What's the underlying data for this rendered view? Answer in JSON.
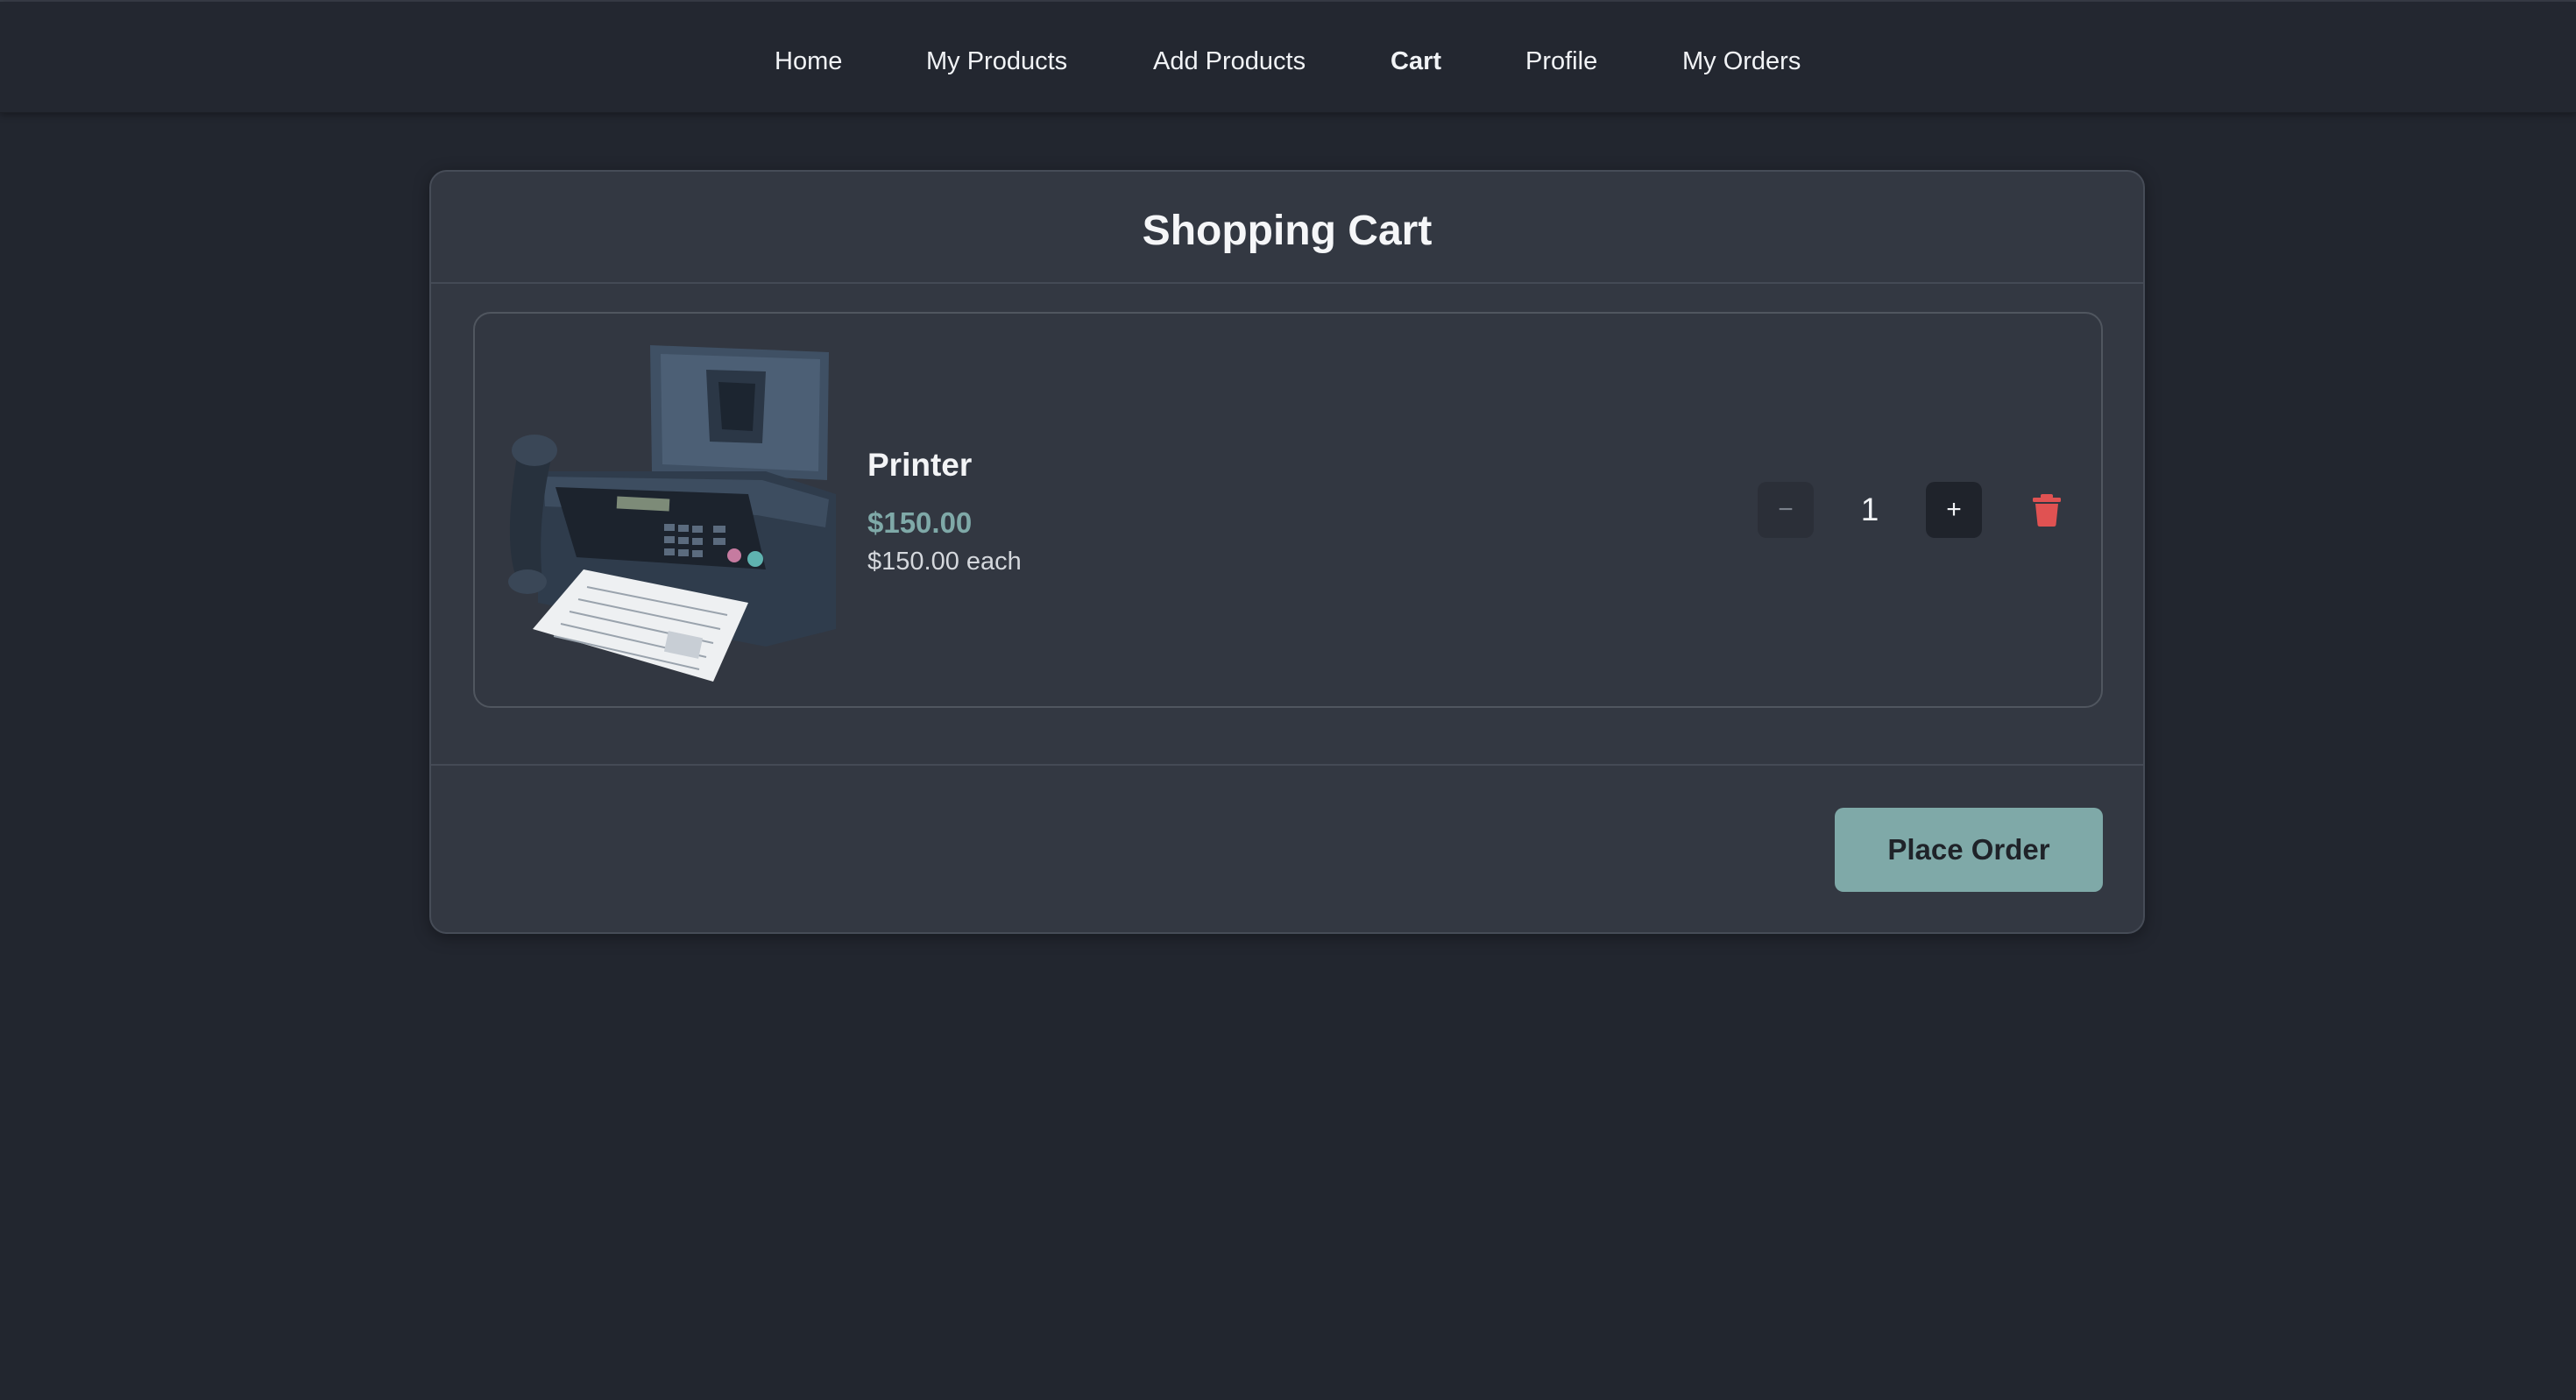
{
  "nav": {
    "items": [
      {
        "label": "Home",
        "active": false
      },
      {
        "label": "My Products",
        "active": false
      },
      {
        "label": "Add Products",
        "active": false
      },
      {
        "label": "Cart",
        "active": true
      },
      {
        "label": "Profile",
        "active": false
      },
      {
        "label": "My Orders",
        "active": false
      }
    ]
  },
  "cart": {
    "title": "Shopping Cart",
    "items": [
      {
        "name": "Printer",
        "total_price": "$150.00",
        "unit_price": "$150.00 each",
        "quantity": "1",
        "decrement_label": "−",
        "increment_label": "+",
        "image_icon": "fax-printer-image",
        "delete_icon": "trash-icon"
      }
    ],
    "place_order_label": "Place Order"
  },
  "colors": {
    "background": "#22262f",
    "card": "#333842",
    "accent": "#7fa9a8",
    "delete": "#e05252"
  }
}
